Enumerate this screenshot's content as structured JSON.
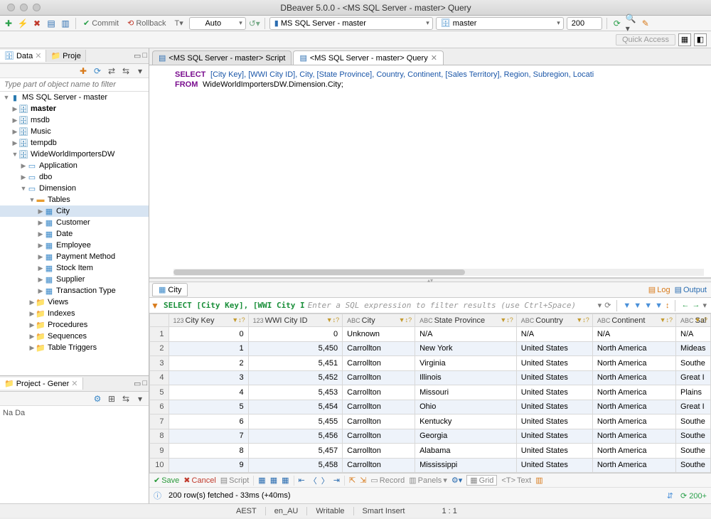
{
  "title": "DBeaver 5.0.0 - <MS SQL Server - master> Query",
  "toolbar": {
    "commit": "Commit",
    "rollback": "Rollback",
    "txn_mode": "Auto",
    "connection": "MS SQL Server - master",
    "database": "master",
    "limit": "200"
  },
  "quick_access": "Quick Access",
  "left": {
    "data_tab": "Data",
    "proj_tab": "Proje",
    "filter_placeholder": "Type part of object name to filter",
    "project_tab_title": "Project - Gener",
    "project_name": "Na Da",
    "tree": {
      "conn": "MS SQL Server - master",
      "dbs": [
        "master",
        "msdb",
        "Music",
        "tempdb"
      ],
      "dw": "WideWorldImportersDW",
      "schemas": [
        "Application",
        "dbo"
      ],
      "dim": "Dimension",
      "tables_label": "Tables",
      "tables": [
        "City",
        "Customer",
        "Date",
        "Employee",
        "Payment Method",
        "Stock Item",
        "Supplier",
        "Transaction Type"
      ],
      "folders": [
        "Views",
        "Indexes",
        "Procedures",
        "Sequences",
        "Table Triggers"
      ]
    }
  },
  "editor": {
    "tab_script": "<MS SQL Server - master> Script",
    "tab_query": "<MS SQL Server - master> Query",
    "sql_select": "SELECT",
    "sql_cols": "[City Key], [WWI City ID], City, [State Province], Country, Continent, [Sales Territory], Region, Subregion, Locati",
    "sql_from": "FROM",
    "sql_table": "WideWorldImportersDW.Dimension.City;"
  },
  "results": {
    "tab": "City",
    "log": "Log",
    "output": "Output",
    "filter_prefix": "SELECT [City Key], [WWI City I",
    "filter_placeholder": "Enter a SQL expression to filter results (use Ctrl+Space)",
    "columns": [
      "City Key",
      "WWI City ID",
      "City",
      "State Province",
      "Country",
      "Continent",
      "Sal"
    ],
    "col_types": [
      "123",
      "123",
      "ABC",
      "ABC",
      "ABC",
      "ABC",
      "ABC"
    ],
    "rows": [
      {
        "n": 1,
        "ck": 0,
        "wwi": 0,
        "city": "Unknown",
        "sp": "N/A",
        "co": "N/A",
        "cont": "N/A",
        "st": "N/A"
      },
      {
        "n": 2,
        "ck": 1,
        "wwi": "5,450",
        "city": "Carrollton",
        "sp": "New York",
        "co": "United States",
        "cont": "North America",
        "st": "Mideas"
      },
      {
        "n": 3,
        "ck": 2,
        "wwi": "5,451",
        "city": "Carrollton",
        "sp": "Virginia",
        "co": "United States",
        "cont": "North America",
        "st": "Southe"
      },
      {
        "n": 4,
        "ck": 3,
        "wwi": "5,452",
        "city": "Carrollton",
        "sp": "Illinois",
        "co": "United States",
        "cont": "North America",
        "st": "Great I"
      },
      {
        "n": 5,
        "ck": 4,
        "wwi": "5,453",
        "city": "Carrollton",
        "sp": "Missouri",
        "co": "United States",
        "cont": "North America",
        "st": "Plains"
      },
      {
        "n": 6,
        "ck": 5,
        "wwi": "5,454",
        "city": "Carrollton",
        "sp": "Ohio",
        "co": "United States",
        "cont": "North America",
        "st": "Great I"
      },
      {
        "n": 7,
        "ck": 6,
        "wwi": "5,455",
        "city": "Carrollton",
        "sp": "Kentucky",
        "co": "United States",
        "cont": "North America",
        "st": "Southe"
      },
      {
        "n": 8,
        "ck": 7,
        "wwi": "5,456",
        "city": "Carrollton",
        "sp": "Georgia",
        "co": "United States",
        "cont": "North America",
        "st": "Southe"
      },
      {
        "n": 9,
        "ck": 8,
        "wwi": "5,457",
        "city": "Carrollton",
        "sp": "Alabama",
        "co": "United States",
        "cont": "North America",
        "st": "Southe"
      },
      {
        "n": 10,
        "ck": 9,
        "wwi": "5,458",
        "city": "Carrollton",
        "sp": "Mississippi",
        "co": "United States",
        "cont": "North America",
        "st": "Southe"
      }
    ],
    "btns": {
      "save": "Save",
      "cancel": "Cancel",
      "script": "Script",
      "record": "Record",
      "panels": "Panels",
      "grid": "Grid",
      "text": "Text"
    },
    "status": "200 row(s) fetched - 33ms (+40ms)",
    "more": "200+"
  },
  "statusbar": {
    "tz": "AEST",
    "locale": "en_AU",
    "mode": "Writable",
    "insert": "Smart Insert",
    "pos": "1 : 1"
  }
}
